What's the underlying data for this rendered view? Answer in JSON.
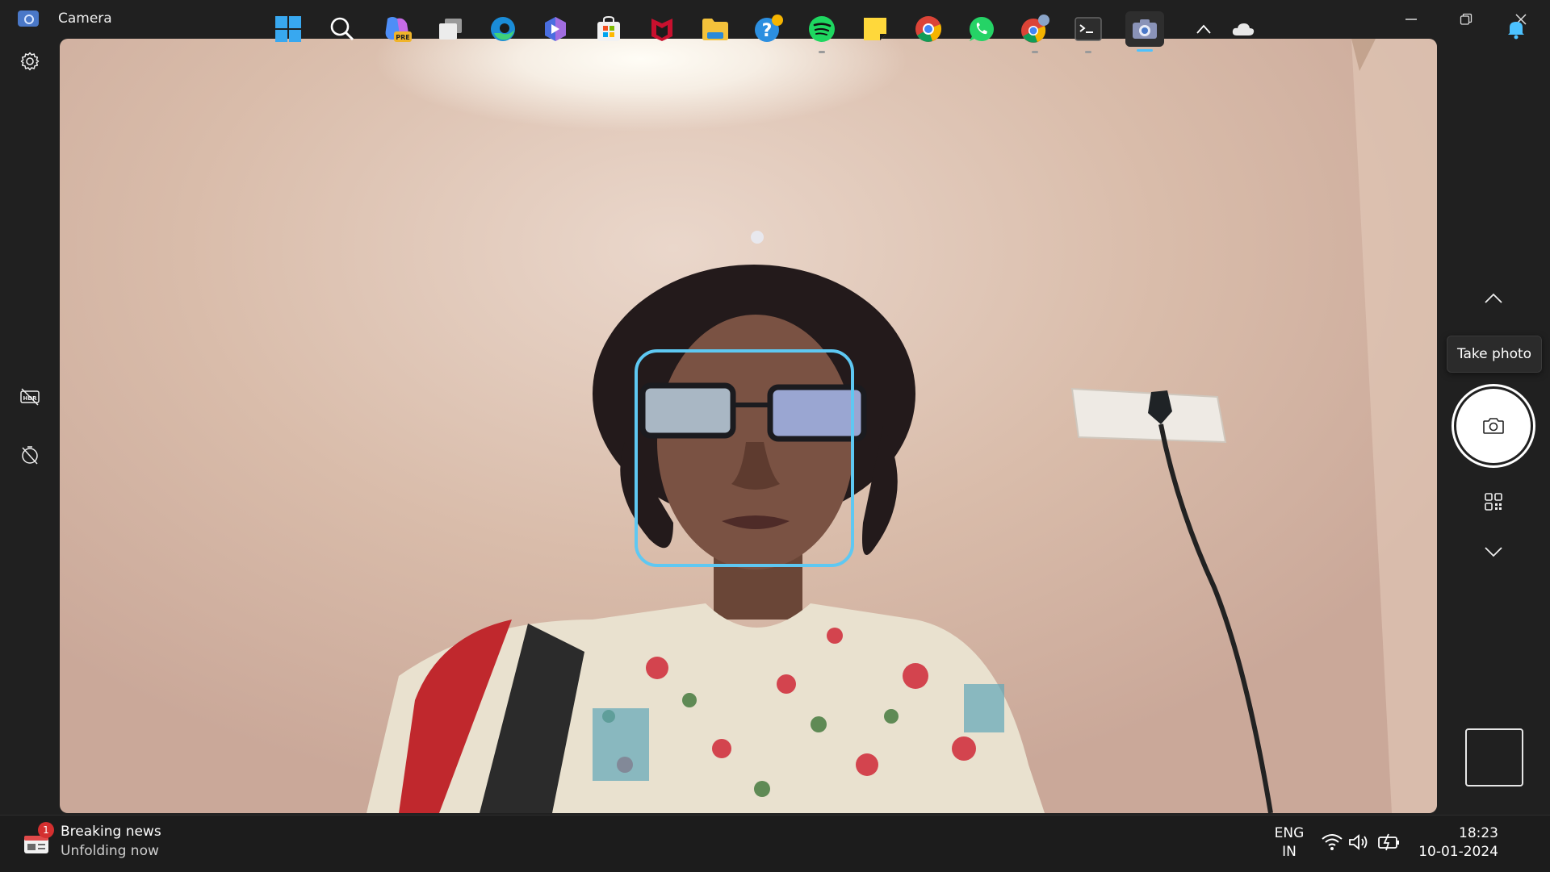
{
  "window": {
    "title": "Camera",
    "minimize_icon": "minimize-icon",
    "maximize_icon": "restore-icon",
    "close_icon": "close-icon"
  },
  "left_rail": {
    "items": [
      {
        "name": "settings",
        "icon": "gear-icon"
      },
      {
        "name": "hdr-off",
        "icon": "hdr-off-icon"
      },
      {
        "name": "timer-off",
        "icon": "timer-off-icon"
      }
    ]
  },
  "right_rail": {
    "tooltip": "Take photo",
    "up_icon": "chevron-up-icon",
    "down_icon": "chevron-down-icon",
    "shutter_icon": "camera-icon",
    "qr_icon": "qr-code-icon"
  },
  "taskbar": {
    "news": {
      "title": "Breaking news",
      "subtitle": "Unfolding now",
      "badge": "1"
    },
    "apps": [
      {
        "name": "start",
        "icon": "windows-icon"
      },
      {
        "name": "search",
        "icon": "search-icon"
      },
      {
        "name": "copilot",
        "icon": "copilot-pre-icon"
      },
      {
        "name": "task-view",
        "icon": "task-view-icon"
      },
      {
        "name": "edge",
        "icon": "edge-icon"
      },
      {
        "name": "bing",
        "icon": "bing-icon"
      },
      {
        "name": "store",
        "icon": "store-icon"
      },
      {
        "name": "mcafee",
        "icon": "mcafee-icon"
      },
      {
        "name": "file-explorer",
        "icon": "folder-icon"
      },
      {
        "name": "get-help",
        "icon": "help-icon"
      },
      {
        "name": "spotify",
        "icon": "spotify-icon"
      },
      {
        "name": "sticky-notes",
        "icon": "sticky-notes-icon"
      },
      {
        "name": "chrome",
        "icon": "chrome-icon"
      },
      {
        "name": "whatsapp",
        "icon": "whatsapp-icon"
      },
      {
        "name": "chrome-profile",
        "icon": "chrome-profile-icon"
      },
      {
        "name": "terminal",
        "icon": "terminal-icon"
      },
      {
        "name": "camera",
        "icon": "camera-icon"
      }
    ],
    "tray": {
      "language": "ENG",
      "region": "IN",
      "time": "18:23",
      "date": "10-01-2024"
    }
  },
  "colors": {
    "face_box": "#5ec8f2",
    "accent": "#4cc2ff",
    "background": "#202020"
  }
}
